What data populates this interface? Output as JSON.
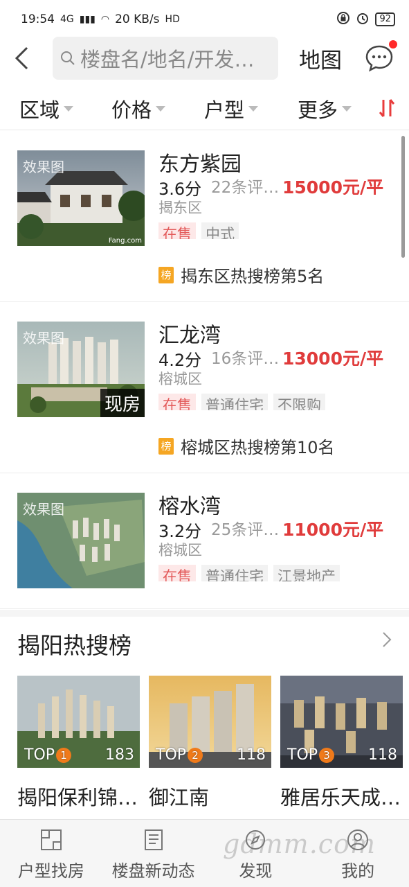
{
  "status_bar": {
    "time": "19:54",
    "network": "4G",
    "speed": "20 KB/s",
    "hd": "HD",
    "battery": "92"
  },
  "header": {
    "search_placeholder": "楼盘名/地名/开发…",
    "map_label": "地图"
  },
  "filters": [
    "区域",
    "价格",
    "户型",
    "更多"
  ],
  "listings": [
    {
      "name": "东方紫园",
      "score": "3.6分",
      "reviews": "22条评…",
      "price": "15000元/平",
      "district": "揭东区",
      "tags": [
        "在售",
        "中式"
      ],
      "rank": "揭东区热搜榜第5名",
      "thumb_tag": "效果图",
      "thumb_brand": "Fang.com",
      "thumb_overlay": ""
    },
    {
      "name": "汇龙湾",
      "score": "4.2分",
      "reviews": "16条评…",
      "price": "13000元/平",
      "district": "榕城区",
      "tags": [
        "在售",
        "普通住宅",
        "不限购"
      ],
      "rank": "榕城区热搜榜第10名",
      "thumb_tag": "效果图",
      "thumb_overlay": "现房"
    },
    {
      "name": "榕水湾",
      "score": "3.2分",
      "reviews": "25条评…",
      "price": "11000元/平",
      "district": "榕城区",
      "tags": [
        "在售",
        "普通住宅",
        "江景地产"
      ],
      "rank": "",
      "thumb_tag": "效果图",
      "thumb_overlay": ""
    }
  ],
  "rank_badge": "榜",
  "hot": {
    "title": "揭阳热搜榜",
    "items": [
      {
        "top_label": "TOP",
        "rank": "1",
        "count": "183",
        "name": "揭阳保利锦…"
      },
      {
        "top_label": "TOP",
        "rank": "2",
        "count": "118",
        "name": "御江南"
      },
      {
        "top_label": "TOP",
        "rank": "3",
        "count": "118",
        "name": "雅居乐天成…"
      }
    ]
  },
  "bottom_nav": [
    "户型找房",
    "楼盘新动态",
    "发现",
    "我的"
  ],
  "watermark": "gdmm.com",
  "colors": {
    "price": "#e03b3b",
    "sale_tag_bg": "#fde8e8",
    "rank_badge": "#f5a623",
    "top_badge": "#f07a1a",
    "unread_dot": "#ff2a2a"
  }
}
